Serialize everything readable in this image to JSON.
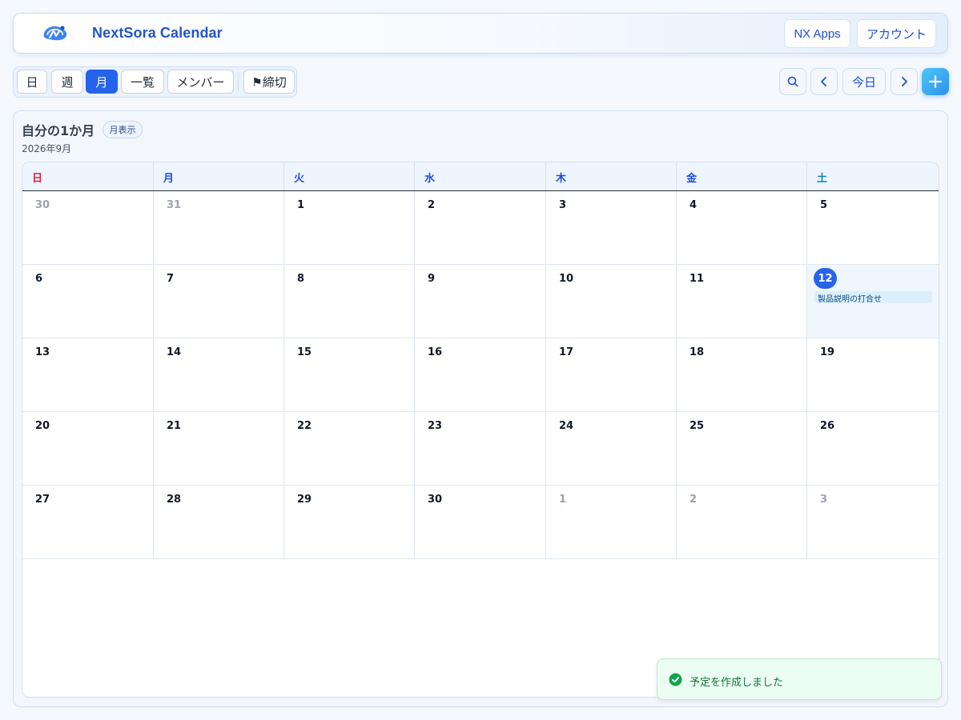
{
  "header": {
    "brand": "NextSora Calendar",
    "apps_label": "NX Apps",
    "account_label": "アカウント",
    "logo_icon": "nextsora-logo-icon"
  },
  "views": {
    "day": "日",
    "week": "週",
    "month": "月",
    "list": "一覧",
    "members": "メンバー",
    "deadline": "⚑締切",
    "active": "month"
  },
  "nav": {
    "search_icon": "search-icon",
    "prev_icon": "chevron-left-icon",
    "today_label": "今日",
    "next_icon": "chevron-right-icon",
    "add_icon": "plus-icon"
  },
  "calendar": {
    "title": "自分の1か月",
    "view_badge": "月表示",
    "month_label": "2026年9月",
    "weekdays": [
      "日",
      "月",
      "火",
      "水",
      "木",
      "金",
      "土"
    ],
    "weeks": [
      [
        "30",
        "31",
        "1",
        "2",
        "3",
        "4",
        "5"
      ],
      [
        "6",
        "7",
        "8",
        "9",
        "10",
        "11",
        "12"
      ],
      [
        "13",
        "14",
        "15",
        "16",
        "17",
        "18",
        "19"
      ],
      [
        "20",
        "21",
        "22",
        "23",
        "24",
        "25",
        "26"
      ],
      [
        "27",
        "28",
        "29",
        "30",
        "1",
        "2",
        "3"
      ]
    ],
    "today": "12",
    "event_title": "製品説明の打合せ"
  },
  "toast": {
    "message": "予定を作成しました",
    "icon": "check-circle-icon"
  },
  "colors": {
    "accent": "#2563eb",
    "sunday": "#e11d48",
    "saturday": "#0e7fc4",
    "success": "#16a34a"
  }
}
